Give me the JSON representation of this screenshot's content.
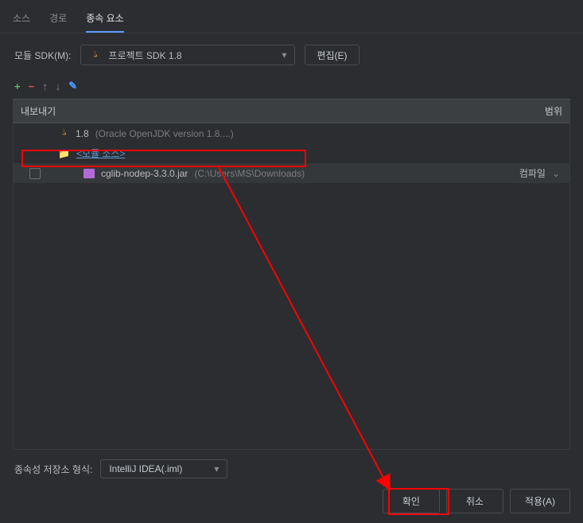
{
  "tabs": {
    "source": "소스",
    "path": "경로",
    "dependencies": "종속 요소"
  },
  "sdk": {
    "label": "모듈 SDK(M):",
    "selected": "프로젝트 SDK 1.8",
    "edit": "편집(E)"
  },
  "listHeader": {
    "export": "내보내기",
    "scope": "범위"
  },
  "rows": {
    "jdk": {
      "name": "1.8",
      "detail": "(Oracle OpenJDK version 1.8....)"
    },
    "moduleSource": "<모듈 소스>",
    "jar": {
      "name": "cglib-nodep-3.3.0.jar",
      "path": "(C:\\Users\\MS\\Downloads)"
    },
    "scope": "컴파일"
  },
  "storage": {
    "label": "종속성 저장소 형식:",
    "value": "IntelliJ IDEA(.iml)"
  },
  "footer": {
    "ok": "확인",
    "cancel": "취소",
    "apply": "적용(A)"
  }
}
